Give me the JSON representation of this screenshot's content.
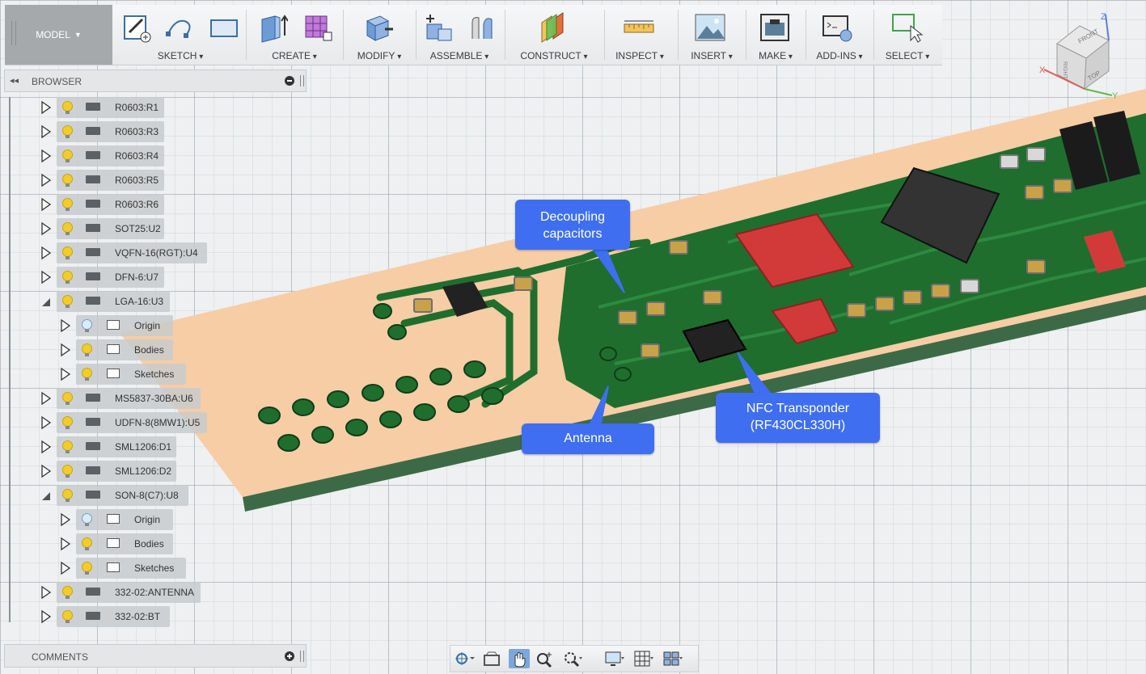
{
  "workspace": {
    "label": "MODEL"
  },
  "toolbar": {
    "groups": [
      {
        "label": "SKETCH"
      },
      {
        "label": "CREATE"
      },
      {
        "label": "MODIFY"
      },
      {
        "label": "ASSEMBLE"
      },
      {
        "label": "CONSTRUCT"
      },
      {
        "label": "INSPECT"
      },
      {
        "label": "INSERT"
      },
      {
        "label": "MAKE"
      },
      {
        "label": "ADD-INS"
      },
      {
        "label": "SELECT"
      }
    ]
  },
  "browser": {
    "title": "BROWSER",
    "items": [
      {
        "label": "R0603:R1",
        "kind": "component",
        "expanded": false
      },
      {
        "label": "R0603:R3",
        "kind": "component",
        "expanded": false
      },
      {
        "label": "R0603:R4",
        "kind": "component",
        "expanded": false
      },
      {
        "label": "R0603:R5",
        "kind": "component",
        "expanded": false
      },
      {
        "label": "R0603:R6",
        "kind": "component",
        "expanded": false
      },
      {
        "label": "SOT25:U2",
        "kind": "component",
        "expanded": false
      },
      {
        "label": "VQFN-16(RGT):U4",
        "kind": "component",
        "expanded": false
      },
      {
        "label": "DFN-6:U7",
        "kind": "component",
        "expanded": false
      },
      {
        "label": "LGA-16:U3",
        "kind": "component",
        "expanded": true
      },
      {
        "label": "Origin",
        "kind": "folder",
        "expanded": false,
        "light": "blue"
      },
      {
        "label": "Bodies",
        "kind": "folder",
        "expanded": false
      },
      {
        "label": "Sketches",
        "kind": "folder",
        "expanded": false
      },
      {
        "label": "MS5837-30BA:U6",
        "kind": "component",
        "expanded": false
      },
      {
        "label": "UDFN-8(8MW1):U5",
        "kind": "component",
        "expanded": false
      },
      {
        "label": "SML1206:D1",
        "kind": "component",
        "expanded": false
      },
      {
        "label": "SML1206:D2",
        "kind": "component",
        "expanded": false
      },
      {
        "label": "SON-8(C7):U8",
        "kind": "component",
        "expanded": true
      },
      {
        "label": "Origin",
        "kind": "folder",
        "expanded": false,
        "light": "blue"
      },
      {
        "label": "Bodies",
        "kind": "folder",
        "expanded": false
      },
      {
        "label": "Sketches",
        "kind": "folder",
        "expanded": false
      },
      {
        "label": "332-02:ANTENNA",
        "kind": "component",
        "expanded": false
      },
      {
        "label": "332-02:BT",
        "kind": "component",
        "expanded": false
      }
    ]
  },
  "comments": {
    "title": "COMMENTS"
  },
  "viewcube": {
    "front": "FRONT",
    "top": "TOP",
    "right": "RIGHT",
    "axis_x": "X",
    "axis_y": "Y",
    "axis_z": "Z"
  },
  "callouts": {
    "decoupling": {
      "line1": "Decoupling",
      "line2": "capacitors"
    },
    "antenna": {
      "line1": "Antenna"
    },
    "nfc": {
      "line1": "NFC Transponder",
      "line2": "(RF430CL330H)"
    }
  },
  "colors": {
    "accent": "#3f6ff0",
    "pcb_green": "#1d6b2c",
    "board": "#f6c9a0",
    "chip_red": "#d23a3a"
  }
}
